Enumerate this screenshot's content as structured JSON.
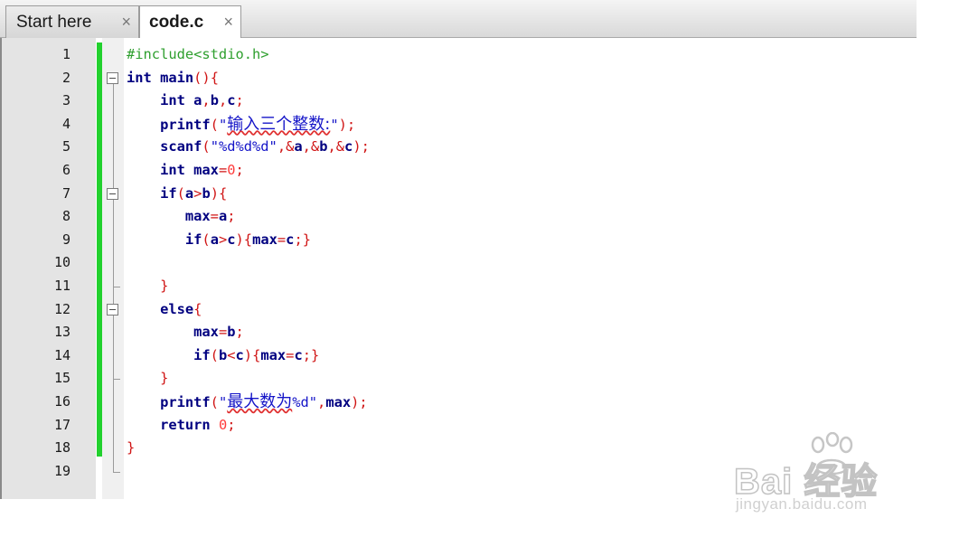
{
  "tabs": [
    {
      "label": "Start here",
      "active": false,
      "close": "×"
    },
    {
      "label": "code.c",
      "active": true,
      "close": "×"
    }
  ],
  "editor": {
    "line_numbers": [
      "1",
      "2",
      "3",
      "4",
      "5",
      "6",
      "7",
      "8",
      "9",
      "10",
      "11",
      "12",
      "13",
      "14",
      "15",
      "16",
      "17",
      "18",
      "19"
    ],
    "lines": [
      [
        {
          "t": "#include<stdio.h>",
          "c": "pp"
        }
      ],
      [
        {
          "t": "int ",
          "c": "kw"
        },
        {
          "t": "main",
          "c": "id"
        },
        {
          "t": "(){",
          "c": "op"
        }
      ],
      [
        {
          "t": "    int ",
          "c": "kw"
        },
        {
          "t": "a",
          "c": "id"
        },
        {
          "t": ",",
          "c": "op"
        },
        {
          "t": "b",
          "c": "id"
        },
        {
          "t": ",",
          "c": "op"
        },
        {
          "t": "c",
          "c": "id"
        },
        {
          "t": ";",
          "c": "op"
        }
      ],
      [
        {
          "t": "    printf",
          "c": "id"
        },
        {
          "t": "(",
          "c": "op"
        },
        {
          "t": "\"",
          "c": "str"
        },
        {
          "t": "输入三个整数:",
          "c": "cjk"
        },
        {
          "t": "\"",
          "c": "str"
        },
        {
          "t": ");",
          "c": "op"
        }
      ],
      [
        {
          "t": "    scanf",
          "c": "id"
        },
        {
          "t": "(",
          "c": "op"
        },
        {
          "t": "\"%d%d%d\"",
          "c": "str"
        },
        {
          "t": ",&",
          "c": "op"
        },
        {
          "t": "a",
          "c": "id"
        },
        {
          "t": ",&",
          "c": "op"
        },
        {
          "t": "b",
          "c": "id"
        },
        {
          "t": ",&",
          "c": "op"
        },
        {
          "t": "c",
          "c": "id"
        },
        {
          "t": ");",
          "c": "op"
        }
      ],
      [
        {
          "t": "    int ",
          "c": "kw"
        },
        {
          "t": "max",
          "c": "id"
        },
        {
          "t": "=",
          "c": "op"
        },
        {
          "t": "0",
          "c": "num"
        },
        {
          "t": ";",
          "c": "op"
        }
      ],
      [
        {
          "t": "    if",
          "c": "kw"
        },
        {
          "t": "(",
          "c": "op"
        },
        {
          "t": "a",
          "c": "id"
        },
        {
          "t": ">",
          "c": "op"
        },
        {
          "t": "b",
          "c": "id"
        },
        {
          "t": "){",
          "c": "op"
        }
      ],
      [
        {
          "t": "       max",
          "c": "id"
        },
        {
          "t": "=",
          "c": "op"
        },
        {
          "t": "a",
          "c": "id"
        },
        {
          "t": ";",
          "c": "op"
        }
      ],
      [
        {
          "t": "       if",
          "c": "kw"
        },
        {
          "t": "(",
          "c": "op"
        },
        {
          "t": "a",
          "c": "id"
        },
        {
          "t": ">",
          "c": "op"
        },
        {
          "t": "c",
          "c": "id"
        },
        {
          "t": "){",
          "c": "op"
        },
        {
          "t": "max",
          "c": "id"
        },
        {
          "t": "=",
          "c": "op"
        },
        {
          "t": "c",
          "c": "id"
        },
        {
          "t": ";}",
          "c": "op"
        }
      ],
      [],
      [
        {
          "t": "    }",
          "c": "op"
        }
      ],
      [
        {
          "t": "    else",
          "c": "kw"
        },
        {
          "t": "{",
          "c": "op"
        }
      ],
      [
        {
          "t": "        max",
          "c": "id"
        },
        {
          "t": "=",
          "c": "op"
        },
        {
          "t": "b",
          "c": "id"
        },
        {
          "t": ";",
          "c": "op"
        }
      ],
      [
        {
          "t": "        if",
          "c": "kw"
        },
        {
          "t": "(",
          "c": "op"
        },
        {
          "t": "b",
          "c": "id"
        },
        {
          "t": "<",
          "c": "op"
        },
        {
          "t": "c",
          "c": "id"
        },
        {
          "t": "){",
          "c": "op"
        },
        {
          "t": "max",
          "c": "id"
        },
        {
          "t": "=",
          "c": "op"
        },
        {
          "t": "c",
          "c": "id"
        },
        {
          "t": ";}",
          "c": "op"
        }
      ],
      [
        {
          "t": "    }",
          "c": "op"
        }
      ],
      [
        {
          "t": "    printf",
          "c": "id"
        },
        {
          "t": "(",
          "c": "op"
        },
        {
          "t": "\"",
          "c": "str"
        },
        {
          "t": "最大数为",
          "c": "cjk"
        },
        {
          "t": "%d\"",
          "c": "str"
        },
        {
          "t": ",",
          "c": "op"
        },
        {
          "t": "max",
          "c": "id"
        },
        {
          "t": ");",
          "c": "op"
        }
      ],
      [
        {
          "t": "    return ",
          "c": "kw"
        },
        {
          "t": "0",
          "c": "num"
        },
        {
          "t": ";",
          "c": "op"
        }
      ],
      [
        {
          "t": "}",
          "c": "op"
        }
      ],
      []
    ],
    "fold_markers": [
      {
        "line": 2,
        "kind": "open"
      },
      {
        "line": 7,
        "kind": "open"
      },
      {
        "line": 11,
        "kind": "end"
      },
      {
        "line": 12,
        "kind": "open"
      },
      {
        "line": 15,
        "kind": "end"
      },
      {
        "line": 19,
        "kind": "end"
      }
    ]
  },
  "watermark": {
    "brand": "Bai  经验",
    "subtitle": "jingyan.baidu.com"
  },
  "colors": {
    "change_bar": "#22d12e",
    "keyword": "#000080",
    "preprocessor": "#2e9f2e",
    "operator": "#d01515",
    "string": "#1515c8",
    "number": "#ff3c3c"
  }
}
